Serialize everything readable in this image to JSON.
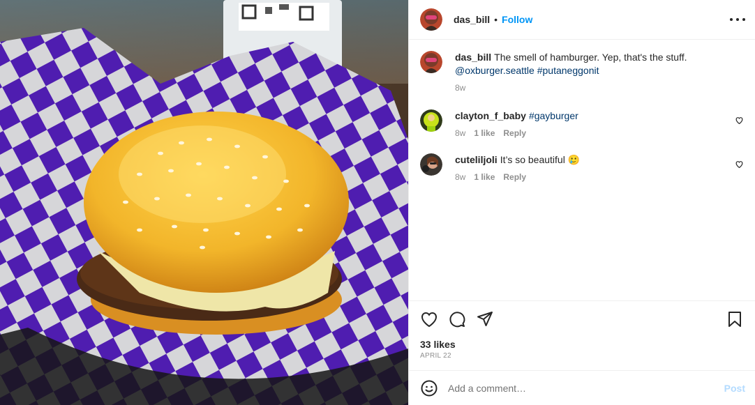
{
  "header": {
    "username": "das_bill",
    "separator": "•",
    "follow_label": "Follow",
    "more_icon": "more-horizontal-icon"
  },
  "comments": [
    {
      "username": "das_bill",
      "text": "The smell of hamburger. Yep, that's the stuff.",
      "mentions": [
        "@oxburger.seattle",
        "#putaneggonit"
      ],
      "age": "8w"
    },
    {
      "username": "clayton_f_baby",
      "text": "#gayburger",
      "age": "8w",
      "likes": "1 like",
      "reply_label": "Reply"
    },
    {
      "username": "cuteliljoli",
      "text": "It’s so beautiful 🥲",
      "age": "8w",
      "likes": "1 like",
      "reply_label": "Reply"
    }
  ],
  "actions": {
    "icons": [
      "heart-icon",
      "comment-icon",
      "share-icon",
      "bookmark-icon"
    ],
    "likes": "33 likes",
    "date": "APRIL 22"
  },
  "add_comment": {
    "placeholder": "Add a comment…",
    "post_label": "Post",
    "emoji_icon": "emoji-icon"
  },
  "colors": {
    "link_blue": "#0095f6",
    "hashtag_blue": "#00376b",
    "muted": "#8e8e8e",
    "post_disabled": "#b3dbff",
    "checker_purple": "#5b21c9"
  }
}
